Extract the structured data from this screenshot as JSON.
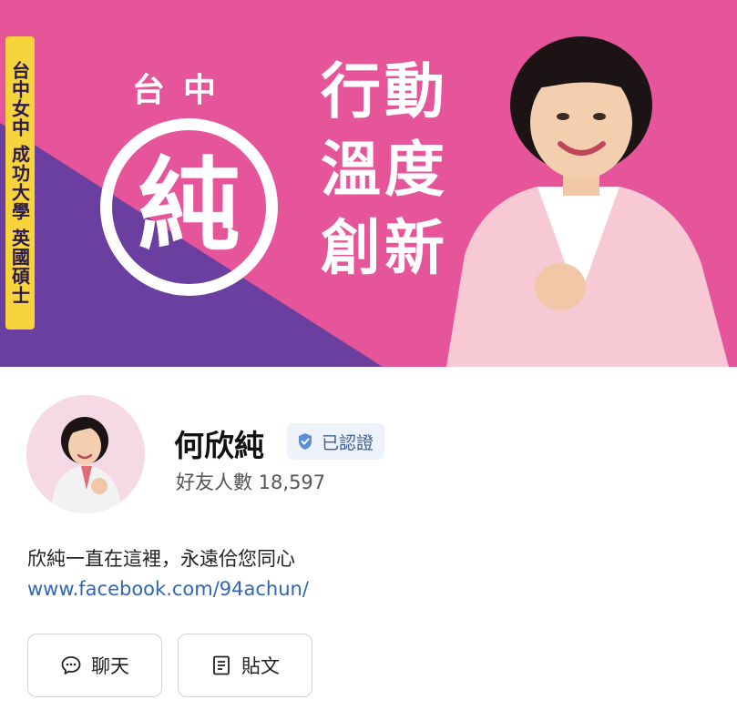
{
  "banner": {
    "tagline": "台中女中 成功大學 英國碩士",
    "city": "台中",
    "logo_char": "純",
    "slogan": [
      "行動",
      "溫度",
      "創新"
    ],
    "colors": {
      "pink": "#e6559a",
      "purple": "#6a3fa0",
      "yellow": "#f7d33c"
    }
  },
  "profile": {
    "name": "何欣純",
    "verified_label": "已認證",
    "friends_text": "好友人數 18,597",
    "description": "欣純一直在這裡，永遠佮您同心",
    "link": "www.facebook.com/94achun/"
  },
  "actions": {
    "chat_label": "聊天",
    "posts_label": "貼文"
  },
  "icons": [
    "verified-badge-icon",
    "chat-bubble-icon",
    "document-icon"
  ]
}
